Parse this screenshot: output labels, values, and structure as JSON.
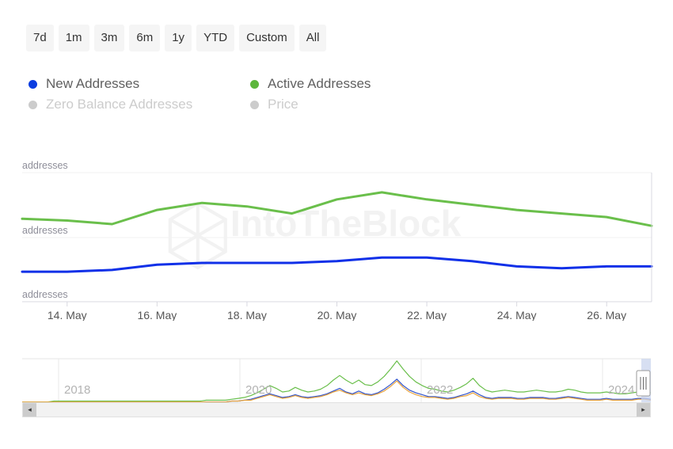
{
  "range_buttons": [
    {
      "label": "7d",
      "name": "range-7d"
    },
    {
      "label": "1m",
      "name": "range-1m"
    },
    {
      "label": "3m",
      "name": "range-3m"
    },
    {
      "label": "6m",
      "name": "range-6m"
    },
    {
      "label": "1y",
      "name": "range-1y"
    },
    {
      "label": "YTD",
      "name": "range-ytd"
    },
    {
      "label": "Custom",
      "name": "range-custom"
    },
    {
      "label": "All",
      "name": "range-all"
    }
  ],
  "legend": [
    {
      "label": "New Addresses",
      "color": "#0b3de0",
      "enabled": true
    },
    {
      "label": "Active Addresses",
      "color": "#5cb63c",
      "enabled": true
    },
    {
      "label": "Zero Balance Addresses",
      "color": "#cccccc",
      "enabled": false
    },
    {
      "label": "Price",
      "color": "#cccccc",
      "enabled": false
    }
  ],
  "watermark": {
    "text": "IntoTheBlock",
    "logo": "hexagon-cube-logo"
  },
  "scrollbar": {
    "left_arrow": "◂",
    "right_arrow": "▸"
  },
  "chart_data": {
    "type": "line",
    "title": "",
    "xlabel": "",
    "ylabel": "addresses",
    "grid": true,
    "legend_position": "top",
    "y_tick_labels": [
      "addresses",
      "addresses",
      "addresses"
    ],
    "x_tick_labels": [
      "14. May",
      "16. May",
      "18. May",
      "20. May",
      "22. May",
      "24. May",
      "26. May"
    ],
    "x": [
      "13. May",
      "14. May",
      "15. May",
      "16. May",
      "17. May",
      "18. May",
      "19. May",
      "20. May",
      "21. May",
      "22. May",
      "23. May",
      "24. May",
      "25. May",
      "26. May",
      "27. May"
    ],
    "series": [
      {
        "name": "New Addresses",
        "color": "#1030e8",
        "values": [
          17,
          17,
          18,
          21,
          22,
          22,
          22,
          23,
          25,
          25,
          23,
          20,
          19,
          20,
          20
        ]
      },
      {
        "name": "Active Addresses",
        "color": "#6abf4b",
        "values": [
          47,
          46,
          44,
          52,
          56,
          54,
          50,
          58,
          62,
          58,
          55,
          52,
          50,
          48,
          43
        ]
      }
    ],
    "navigator": {
      "type": "line",
      "year_ticks": [
        "2018",
        "2020",
        "2022",
        "2024"
      ],
      "series": [
        {
          "name": "Active Addresses",
          "color": "#6abf4b",
          "values": [
            2,
            2,
            2,
            2,
            2,
            3,
            3,
            3,
            3,
            3,
            3,
            3,
            3,
            3,
            3,
            3,
            3,
            3,
            3,
            3,
            3,
            3,
            3,
            3,
            3,
            3,
            3,
            3,
            3,
            4,
            4,
            4,
            4,
            5,
            6,
            7,
            9,
            12,
            16,
            20,
            17,
            13,
            14,
            18,
            15,
            13,
            14,
            16,
            20,
            26,
            31,
            26,
            22,
            26,
            21,
            20,
            24,
            30,
            38,
            47,
            38,
            30,
            24,
            20,
            17,
            16,
            14,
            13,
            15,
            18,
            22,
            28,
            20,
            15,
            13,
            14,
            15,
            14,
            13,
            13,
            14,
            15,
            14,
            13,
            13,
            14,
            16,
            15,
            13,
            12,
            12,
            12,
            13,
            12,
            11,
            11,
            12,
            13,
            14,
            12
          ]
        },
        {
          "name": "New Addresses",
          "color": "#3355cc",
          "values": [
            1,
            1,
            1,
            1,
            1,
            1,
            1,
            1,
            1,
            1,
            1,
            1,
            1,
            1,
            1,
            1,
            1,
            1,
            1,
            1,
            1,
            1,
            1,
            1,
            1,
            1,
            1,
            1,
            1,
            2,
            2,
            2,
            2,
            3,
            3,
            4,
            5,
            7,
            9,
            11,
            9,
            7,
            8,
            10,
            8,
            7,
            8,
            9,
            11,
            14,
            17,
            13,
            11,
            14,
            11,
            10,
            12,
            16,
            21,
            27,
            20,
            15,
            12,
            10,
            8,
            8,
            7,
            6,
            7,
            9,
            11,
            14,
            10,
            7,
            6,
            7,
            7,
            7,
            6,
            6,
            7,
            7,
            7,
            6,
            6,
            7,
            8,
            7,
            6,
            5,
            5,
            5,
            6,
            5,
            5,
            5,
            5,
            6,
            6,
            5
          ]
        },
        {
          "name": "Price",
          "color": "#e8a33d",
          "values": [
            2,
            2,
            2,
            2,
            2,
            2,
            2,
            2,
            2,
            2,
            2,
            2,
            2,
            2,
            2,
            2,
            2,
            2,
            2,
            2,
            2,
            2,
            2,
            2,
            2,
            2,
            2,
            2,
            2,
            2,
            2,
            2,
            2,
            3,
            3,
            4,
            4,
            6,
            8,
            10,
            8,
            6,
            7,
            9,
            7,
            6,
            7,
            8,
            10,
            13,
            15,
            12,
            10,
            12,
            10,
            9,
            11,
            14,
            19,
            25,
            18,
            13,
            10,
            8,
            7,
            7,
            6,
            5,
            6,
            8,
            9,
            12,
            8,
            6,
            5,
            6,
            6,
            6,
            5,
            5,
            6,
            6,
            6,
            5,
            5,
            6,
            7,
            6,
            5,
            4,
            4,
            4,
            5,
            4,
            4,
            4,
            4,
            5,
            5,
            4
          ]
        }
      ]
    }
  }
}
